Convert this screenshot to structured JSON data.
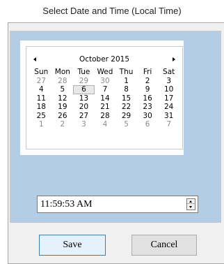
{
  "window": {
    "title": "Select Date and Time (Local Time)"
  },
  "calendar": {
    "month_label": "October 2015",
    "weekdays": [
      "Sun",
      "Mon",
      "Tue",
      "Wed",
      "Thu",
      "Fri",
      "Sat"
    ],
    "weeks": [
      [
        {
          "d": "27",
          "o": true
        },
        {
          "d": "28",
          "o": true
        },
        {
          "d": "29",
          "o": true
        },
        {
          "d": "30",
          "o": true
        },
        {
          "d": "1"
        },
        {
          "d": "2"
        },
        {
          "d": "3"
        }
      ],
      [
        {
          "d": "4"
        },
        {
          "d": "5"
        },
        {
          "d": "6",
          "today": true
        },
        {
          "d": "7"
        },
        {
          "d": "8"
        },
        {
          "d": "9"
        },
        {
          "d": "10"
        }
      ],
      [
        {
          "d": "11"
        },
        {
          "d": "12"
        },
        {
          "d": "13"
        },
        {
          "d": "14"
        },
        {
          "d": "15"
        },
        {
          "d": "16"
        },
        {
          "d": "17"
        }
      ],
      [
        {
          "d": "18"
        },
        {
          "d": "19"
        },
        {
          "d": "20"
        },
        {
          "d": "21"
        },
        {
          "d": "22"
        },
        {
          "d": "23"
        },
        {
          "d": "24"
        }
      ],
      [
        {
          "d": "25"
        },
        {
          "d": "26"
        },
        {
          "d": "27"
        },
        {
          "d": "28"
        },
        {
          "d": "29"
        },
        {
          "d": "30"
        },
        {
          "d": "31"
        }
      ],
      [
        {
          "d": "1",
          "o": true
        },
        {
          "d": "2",
          "o": true
        },
        {
          "d": "3",
          "o": true
        },
        {
          "d": "4",
          "o": true
        },
        {
          "d": "5",
          "o": true
        },
        {
          "d": "6",
          "o": true
        },
        {
          "d": "7",
          "o": true
        }
      ]
    ],
    "prev_icon": "triangle-left-icon",
    "next_icon": "triangle-right-icon"
  },
  "time": {
    "value": "11:59:53 AM",
    "spin_icon": "up-down-spinner-icon"
  },
  "buttons": {
    "save": "Save",
    "cancel": "Cancel"
  },
  "colors": {
    "panel_bg": "#b4cde6",
    "frame_bg": "#f0f0f0",
    "save_border": "#3c7fb1"
  }
}
